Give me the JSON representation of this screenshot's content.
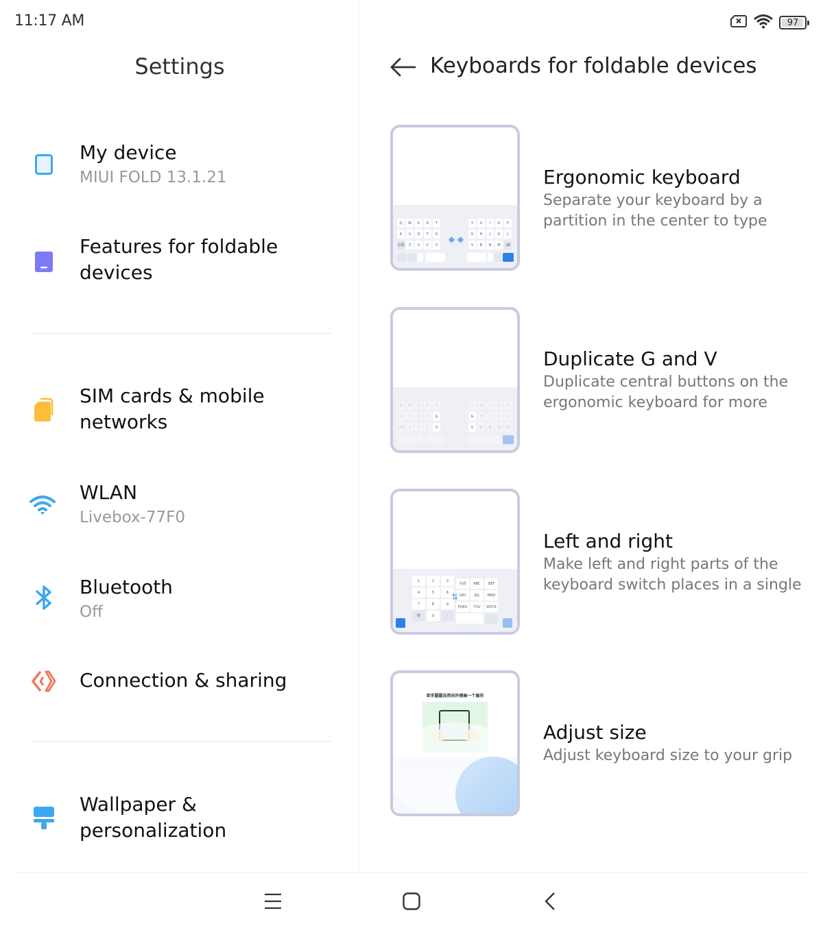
{
  "status_bar": {
    "time": "11:17 AM",
    "icons": [
      "sim-missing-icon",
      "wifi-icon",
      "battery-icon"
    ],
    "battery_level": 97,
    "battery_text": "97"
  },
  "settings": {
    "title": "Settings",
    "items": [
      {
        "label": "My device",
        "sub": "MIUI FOLD 13.1.21",
        "icon": "tablet-icon",
        "color": "#3da7f0"
      },
      {
        "label": "Features for foldable devices",
        "sub": "",
        "icon": "foldable-icon",
        "color": "#7b7bf5"
      },
      {
        "label": "SIM cards & mobile networks",
        "sub": "",
        "icon": "sim-cards-icon",
        "color": "#fbbd3b"
      },
      {
        "label": "WLAN",
        "sub": "Livebox-77F0",
        "icon": "wifi-icon",
        "color": "#3da7f0"
      },
      {
        "label": "Bluetooth",
        "sub": "Off",
        "icon": "bluetooth-icon",
        "color": "#3da7f0"
      },
      {
        "label": "Connection & sharing",
        "sub": "",
        "icon": "connection-sharing-icon",
        "color": "#f07860"
      },
      {
        "label": "Wallpaper & personalization",
        "sub": "",
        "icon": "paint-brush-icon",
        "color": "#3da7f0"
      }
    ]
  },
  "detail": {
    "title": "Keyboards for foldable devices",
    "back_icon": "arrow-left-icon",
    "options": [
      {
        "title": "Ergonomic keyboard",
        "desc": "Separate your keyboard by a partition in the center to type"
      },
      {
        "title": "Duplicate G and V",
        "desc": "Duplicate central buttons on the ergonomic keyboard for more"
      },
      {
        "title": "Left and right",
        "desc": "Make left and right parts of the keyboard switch places in a single"
      },
      {
        "title": "Adjust size",
        "desc": "Adjust keyboard size to your grip"
      }
    ],
    "preview_keys": {
      "row1_left": [
        "Q",
        "W",
        "E",
        "R",
        "T"
      ],
      "row1_right": [
        "Y",
        "U",
        "I",
        "O",
        "P"
      ],
      "row2_left": [
        "A",
        "S",
        "D",
        "F",
        "G"
      ],
      "row2_right": [
        "G",
        "H",
        "J",
        "K",
        "L"
      ],
      "row3_left": [
        "分词",
        "Z",
        "X",
        "C",
        "V"
      ],
      "row3_right": [
        "V",
        "B",
        "N",
        "M",
        "⌫"
      ],
      "numpad": [
        "1",
        "2",
        "3",
        "4",
        "5",
        "6",
        "7",
        "8",
        "9",
        "符",
        "0",
        "·"
      ],
      "t9": [
        "分词",
        "ABC",
        "DEF",
        "GHI",
        "JKL",
        "MNO",
        "PQRS",
        "TUV",
        "WXYZ"
      ],
      "adjust_caption": "单手握握自然向外侧画一个扇形"
    }
  },
  "nav_bar": {
    "buttons": [
      "menu-icon",
      "home-icon",
      "back-icon"
    ]
  },
  "colors": {
    "accent_blue": "#2f7fe8",
    "preview_border": "#c8cbe0",
    "subtext": "#999999"
  }
}
